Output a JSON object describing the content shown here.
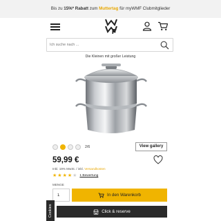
{
  "promo": {
    "prefix": "Bis zu ",
    "discount": "15%* Rabatt",
    "middle": " zum ",
    "occasion": "Muttertag",
    "suffix": " für myWMF Clubmitglieder",
    "accent_color": "#e8a700"
  },
  "header": {
    "menu_icon": "hamburger-icon",
    "logo_icon": "wmf-logo",
    "account_icon": "user-icon",
    "cart_icon": "cart-icon"
  },
  "search": {
    "placeholder": "Ich suche nach ...",
    "icon": "search-icon"
  },
  "product": {
    "tagline": "Die Kleinen mit großer Leistung",
    "image_icon": "steamer-pot-image",
    "swatches": {
      "count_label": "2/6",
      "selected_index": 1
    },
    "view_gallery_label": "View gallery",
    "price": "59,99 €",
    "tax_prefix": "Inkl. 19% MwSt. / inkl. ",
    "tax_link": "Versandkosten",
    "rating": {
      "stars": 4,
      "max": 5
    },
    "review_link": "1 Bewertung",
    "wishlist_icon": "heart-icon"
  },
  "purchase": {
    "quantity_label": "MENGE",
    "quantity_value": "1",
    "add_to_cart_label": "In den Warenkorb",
    "add_to_cart_icon": "cart-icon",
    "click_reserve_label": "Click & reserve",
    "click_reserve_icon": "store-icon",
    "button_color": "#f0b400"
  },
  "cookies": {
    "label": "Cookies"
  }
}
